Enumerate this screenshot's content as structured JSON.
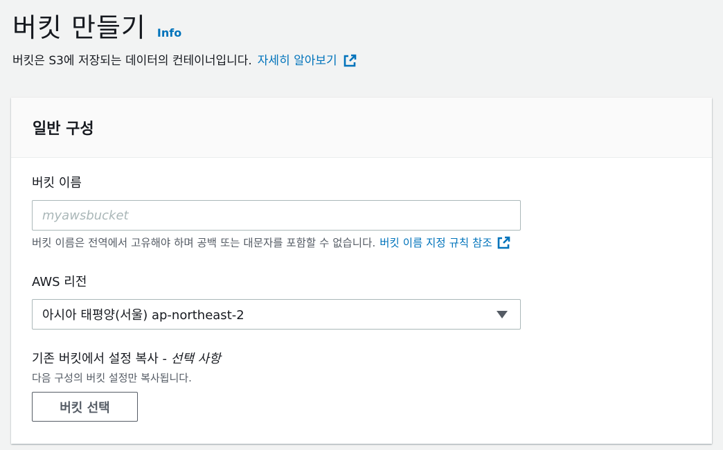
{
  "header": {
    "title": "버킷 만들기",
    "info_label": "Info",
    "description": "버킷은 S3에 저장되는 데이터의 컨테이너입니다.",
    "learn_more_label": "자세히 알아보기"
  },
  "general_config": {
    "section_title": "일반 구성",
    "bucket_name": {
      "label": "버킷 이름",
      "value": "",
      "placeholder": "myawsbucket",
      "hint": "버킷 이름은 전역에서 고유해야 하며 공백 또는 대문자를 포함할 수 없습니다.",
      "rules_link_label": "버킷 이름 지정 규칙 참조"
    },
    "region": {
      "label": "AWS 리전",
      "selected": "아시아 태평양(서울) ap-northeast-2"
    },
    "copy_settings": {
      "label": "기존 버킷에서 설정 복사 -",
      "optional_label": "선택 사항",
      "description": "다음 구성의 버킷 설정만 복사됩니다.",
      "button_label": "버킷 선택"
    }
  },
  "colors": {
    "link": "#0073bb",
    "border": "#aab7b8",
    "background": "#f2f3f3"
  },
  "icons": {
    "external_link": "external-link-icon",
    "dropdown": "caret-down-icon"
  }
}
